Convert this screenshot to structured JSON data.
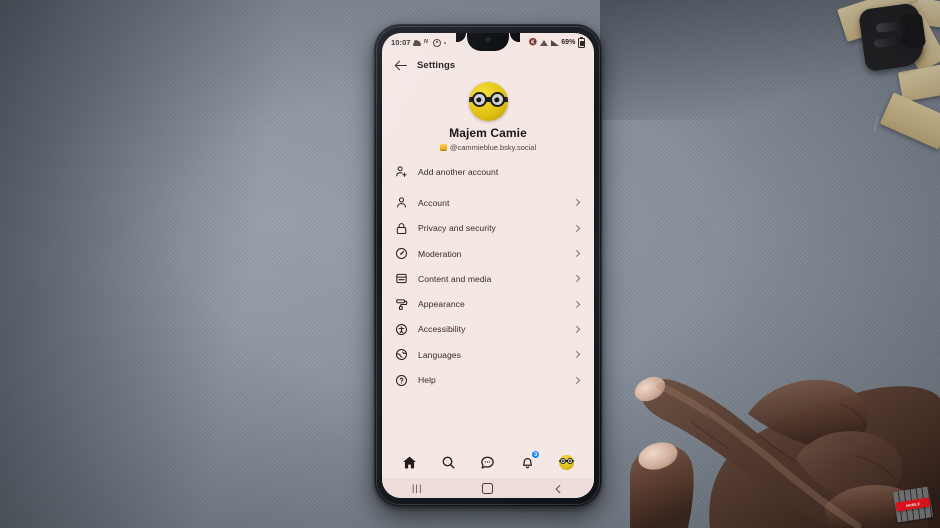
{
  "scene": {
    "description": "Hand pointing at an Android phone showing Bluesky Settings screen on a grey desk",
    "desk_color": "#8d96a1",
    "watermark_text": "MOBILE"
  },
  "phone": {
    "frame_color": "#14171c",
    "screen_bg": "#f4e7e4"
  },
  "status_bar": {
    "time": "10:07",
    "left_icons": [
      "cloud-icon",
      "n-icon",
      "at-icon",
      "dot-icon"
    ],
    "right_icons": [
      "mute-icon",
      "wifi-icon",
      "signal-icon"
    ],
    "battery_percent": "69%"
  },
  "app_bar": {
    "back_icon": "back-arrow-icon",
    "title": "Settings"
  },
  "profile": {
    "avatar": "minion-avatar",
    "display_name": "Majem Camie",
    "handle_badge": "verified-badge-icon",
    "handle": "@cammieblue.bsky.social"
  },
  "settings": {
    "add_account": {
      "icon": "person-add-icon",
      "label": "Add another account"
    },
    "items": [
      {
        "icon": "person-icon",
        "label": "Account",
        "chevron": "chevron-right-icon"
      },
      {
        "icon": "lock-icon",
        "label": "Privacy and security",
        "chevron": "chevron-right-icon"
      },
      {
        "icon": "gauge-icon",
        "label": "Moderation",
        "chevron": "chevron-right-icon"
      },
      {
        "icon": "window-icon",
        "label": "Content and media",
        "chevron": "chevron-right-icon"
      },
      {
        "icon": "paint-roller-icon",
        "label": "Appearance",
        "chevron": "chevron-right-icon"
      },
      {
        "icon": "accessibility-icon",
        "label": "Accessibility",
        "chevron": "chevron-right-icon"
      },
      {
        "icon": "globe-icon",
        "label": "Languages",
        "chevron": "chevron-right-icon"
      },
      {
        "icon": "help-circle-icon",
        "label": "Help",
        "chevron": "chevron-right-icon"
      }
    ]
  },
  "bottom_nav": {
    "accent_color": "#1185fe",
    "items": [
      {
        "icon": "home-icon",
        "label": "Home",
        "badge": ""
      },
      {
        "icon": "search-icon",
        "label": "Search",
        "badge": ""
      },
      {
        "icon": "chat-bubble-icon",
        "label": "Chat",
        "badge": ""
      },
      {
        "icon": "bell-icon",
        "label": "Notifications",
        "badge": "3"
      },
      {
        "icon": "profile-avatar-icon",
        "label": "Profile",
        "badge": ""
      }
    ]
  },
  "system_nav": {
    "recents": "|||",
    "recents_name": "recents-button",
    "home_name": "home-button",
    "back_name": "back-button"
  }
}
